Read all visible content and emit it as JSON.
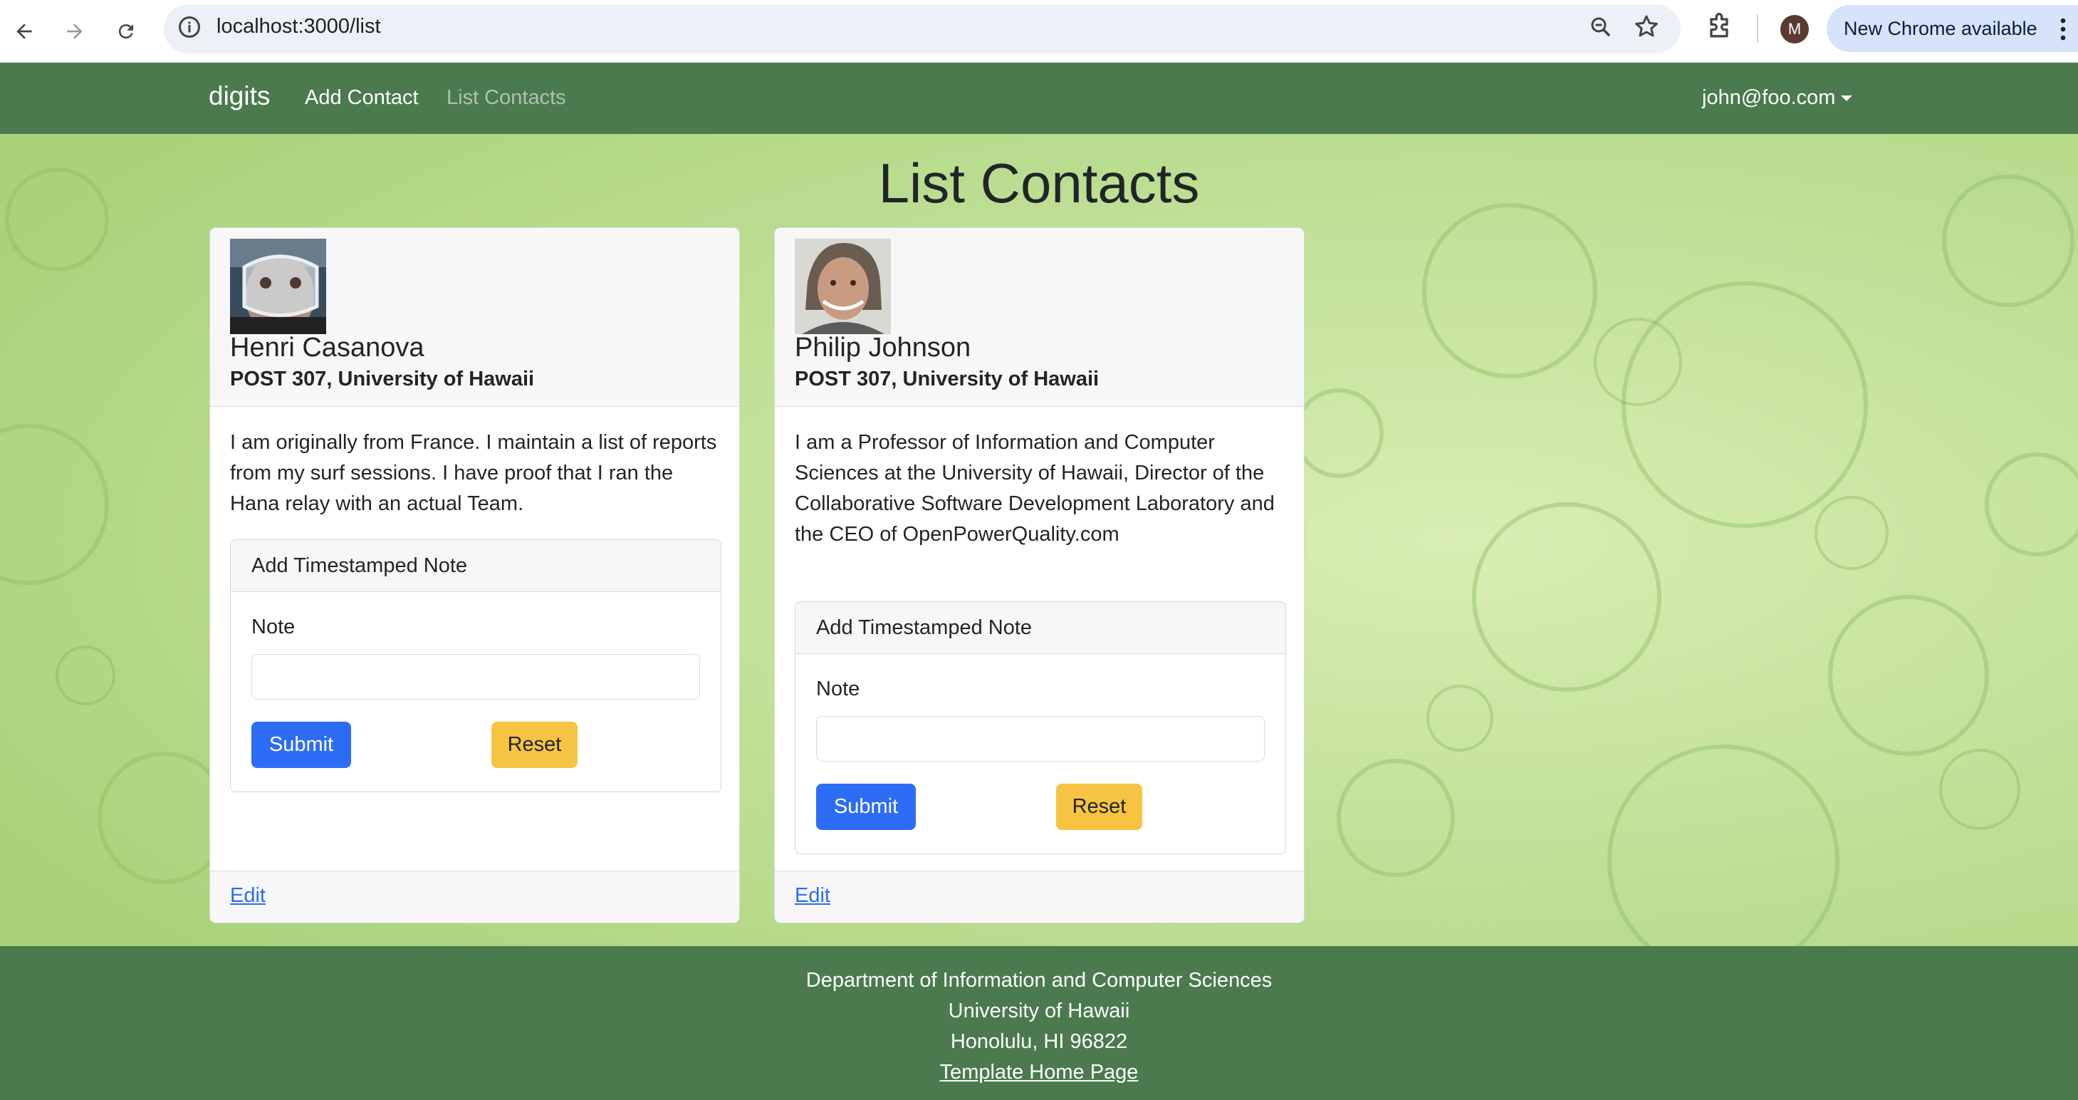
{
  "browser": {
    "url": "localhost:3000/list",
    "update_label": "New Chrome available",
    "profile_initial": "M"
  },
  "navbar": {
    "brand": "digits",
    "add_contact": "Add Contact",
    "list_contacts": "List Contacts",
    "user": "john@foo.com"
  },
  "page": {
    "title": "List Contacts"
  },
  "contacts": [
    {
      "name": "Henri Casanova",
      "address": "POST 307, University of Hawaii",
      "description": "I am originally from France. I maintain a list of reports from my surf sessions. I have proof that I ran the Hana relay with an actual Team.",
      "note_header": "Add Timestamped Note",
      "note_label": "Note",
      "submit": "Submit",
      "reset": "Reset",
      "edit": "Edit"
    },
    {
      "name": "Philip Johnson",
      "address": "POST 307, University of Hawaii",
      "description": "I am a Professor of Information and Computer Sciences at the University of Hawaii, Director of the Collaborative Software Development Laboratory and the CEO of OpenPowerQuality.com",
      "note_header": "Add Timestamped Note",
      "note_label": "Note",
      "submit": "Submit",
      "reset": "Reset",
      "edit": "Edit"
    }
  ],
  "footer": {
    "line1": "Department of Information and Computer Sciences",
    "line2": "University of Hawaii",
    "line3": "Honolulu, HI 96822",
    "link": "Template Home Page"
  },
  "colors": {
    "navbar": "#4a7a4e",
    "background": "#c4e29a",
    "submit": "#2d6df5",
    "reset": "#f6c343"
  }
}
